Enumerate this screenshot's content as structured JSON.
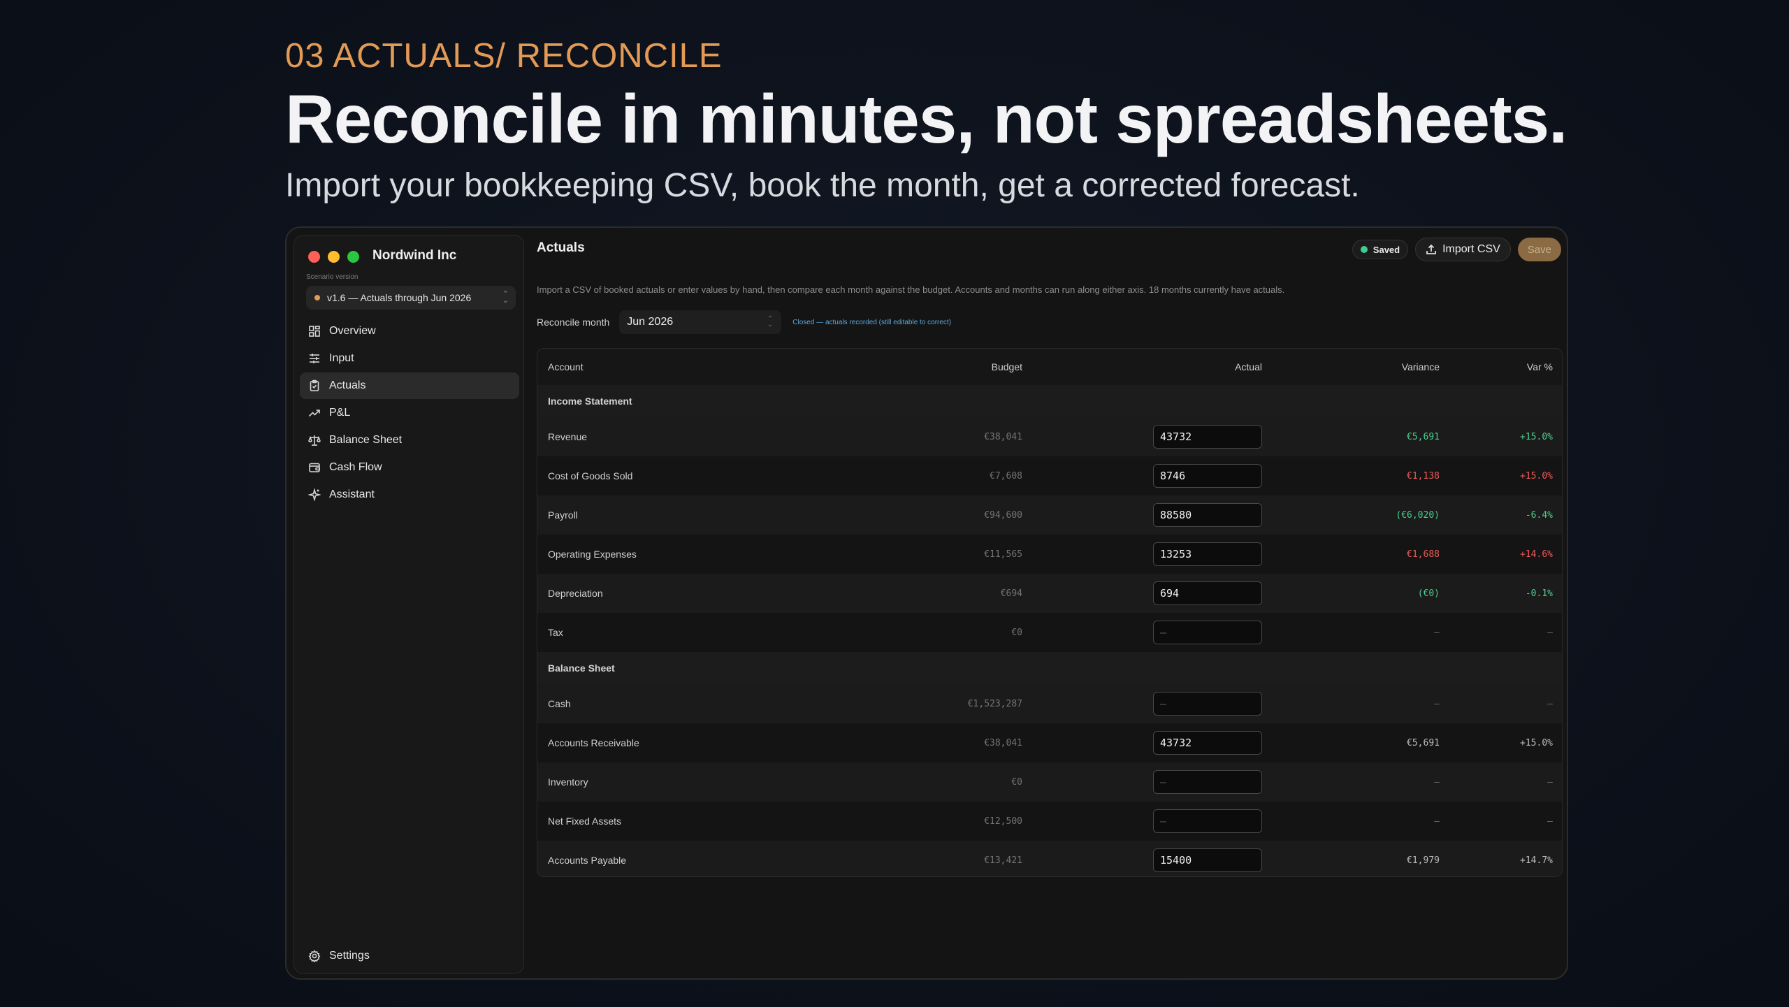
{
  "hero": {
    "eyebrow": "03 ACTUALS/ RECONCILE",
    "headline": "Reconcile in minutes, not spreadsheets.",
    "subhead": "Import your bookkeeping CSV, book the month, get a corrected forecast."
  },
  "sidebar": {
    "company": "Nordwind Inc",
    "scenario_label": "Scenario version",
    "scenario_value": "v1.6 — Actuals through Jun 2026",
    "items": [
      {
        "label": "Overview",
        "icon": "grid-icon"
      },
      {
        "label": "Input",
        "icon": "sliders-icon"
      },
      {
        "label": "Actuals",
        "icon": "clipboard-check-icon"
      },
      {
        "label": "P&L",
        "icon": "trend-up-icon"
      },
      {
        "label": "Balance Sheet",
        "icon": "scale-icon"
      },
      {
        "label": "Cash Flow",
        "icon": "wallet-icon"
      },
      {
        "label": "Assistant",
        "icon": "sparkle-icon"
      }
    ],
    "active_item": "Actuals",
    "settings_label": "Settings"
  },
  "main": {
    "title": "Actuals",
    "saved_label": "Saved",
    "import_label": "Import CSV",
    "save_label": "Save",
    "description": "Import a CSV of booked actuals or enter values by hand, then compare each month against the budget. Accounts and months can run along either axis. 18 months currently have actuals.",
    "reconcile_label": "Reconcile month",
    "reconcile_value": "Jun 2026",
    "reconcile_note": "Closed — actuals recorded (still editable to correct)"
  },
  "table": {
    "headers": {
      "account": "Account",
      "budget": "Budget",
      "actual": "Actual",
      "variance": "Variance",
      "var_pct": "Var %"
    },
    "sections": [
      {
        "title": "Income Statement",
        "rows": [
          {
            "account": "Revenue",
            "budget": "€38,041",
            "actual": "43732",
            "variance": "€5,691",
            "var_pct": "+15.0%",
            "tone": "green"
          },
          {
            "account": "Cost of Goods Sold",
            "budget": "€7,608",
            "actual": "8746",
            "variance": "€1,138",
            "var_pct": "+15.0%",
            "tone": "red"
          },
          {
            "account": "Payroll",
            "budget": "€94,600",
            "actual": "88580",
            "variance": "(€6,020)",
            "var_pct": "-6.4%",
            "tone": "green"
          },
          {
            "account": "Operating Expenses",
            "budget": "€11,565",
            "actual": "13253",
            "variance": "€1,688",
            "var_pct": "+14.6%",
            "tone": "red"
          },
          {
            "account": "Depreciation",
            "budget": "€694",
            "actual": "694",
            "variance": "(€0)",
            "var_pct": "-0.1%",
            "tone": "green"
          },
          {
            "account": "Tax",
            "budget": "€0",
            "actual": "",
            "placeholder": "—",
            "variance": "—",
            "var_pct": "—",
            "tone": "dash"
          }
        ]
      },
      {
        "title": "Balance Sheet",
        "rows": [
          {
            "account": "Cash",
            "budget": "€1,523,287",
            "actual": "",
            "placeholder": "—",
            "variance": "—",
            "var_pct": "—",
            "tone": "dash"
          },
          {
            "account": "Accounts Receivable",
            "budget": "€38,041",
            "actual": "43732",
            "variance": "€5,691",
            "var_pct": "+15.0%",
            "tone": "neutral"
          },
          {
            "account": "Inventory",
            "budget": "€0",
            "actual": "",
            "placeholder": "—",
            "variance": "—",
            "var_pct": "—",
            "tone": "dash"
          },
          {
            "account": "Net Fixed Assets",
            "budget": "€12,500",
            "actual": "",
            "placeholder": "—",
            "variance": "—",
            "var_pct": "—",
            "tone": "dash"
          },
          {
            "account": "Accounts Payable",
            "budget": "€13,421",
            "actual": "15400",
            "variance": "€1,979",
            "var_pct": "+14.7%",
            "tone": "neutral"
          }
        ]
      }
    ]
  },
  "colors": {
    "accent": "#e39a55",
    "positive": "#4cd08e",
    "negative": "#ef5a5a",
    "link": "#59a8e0"
  }
}
